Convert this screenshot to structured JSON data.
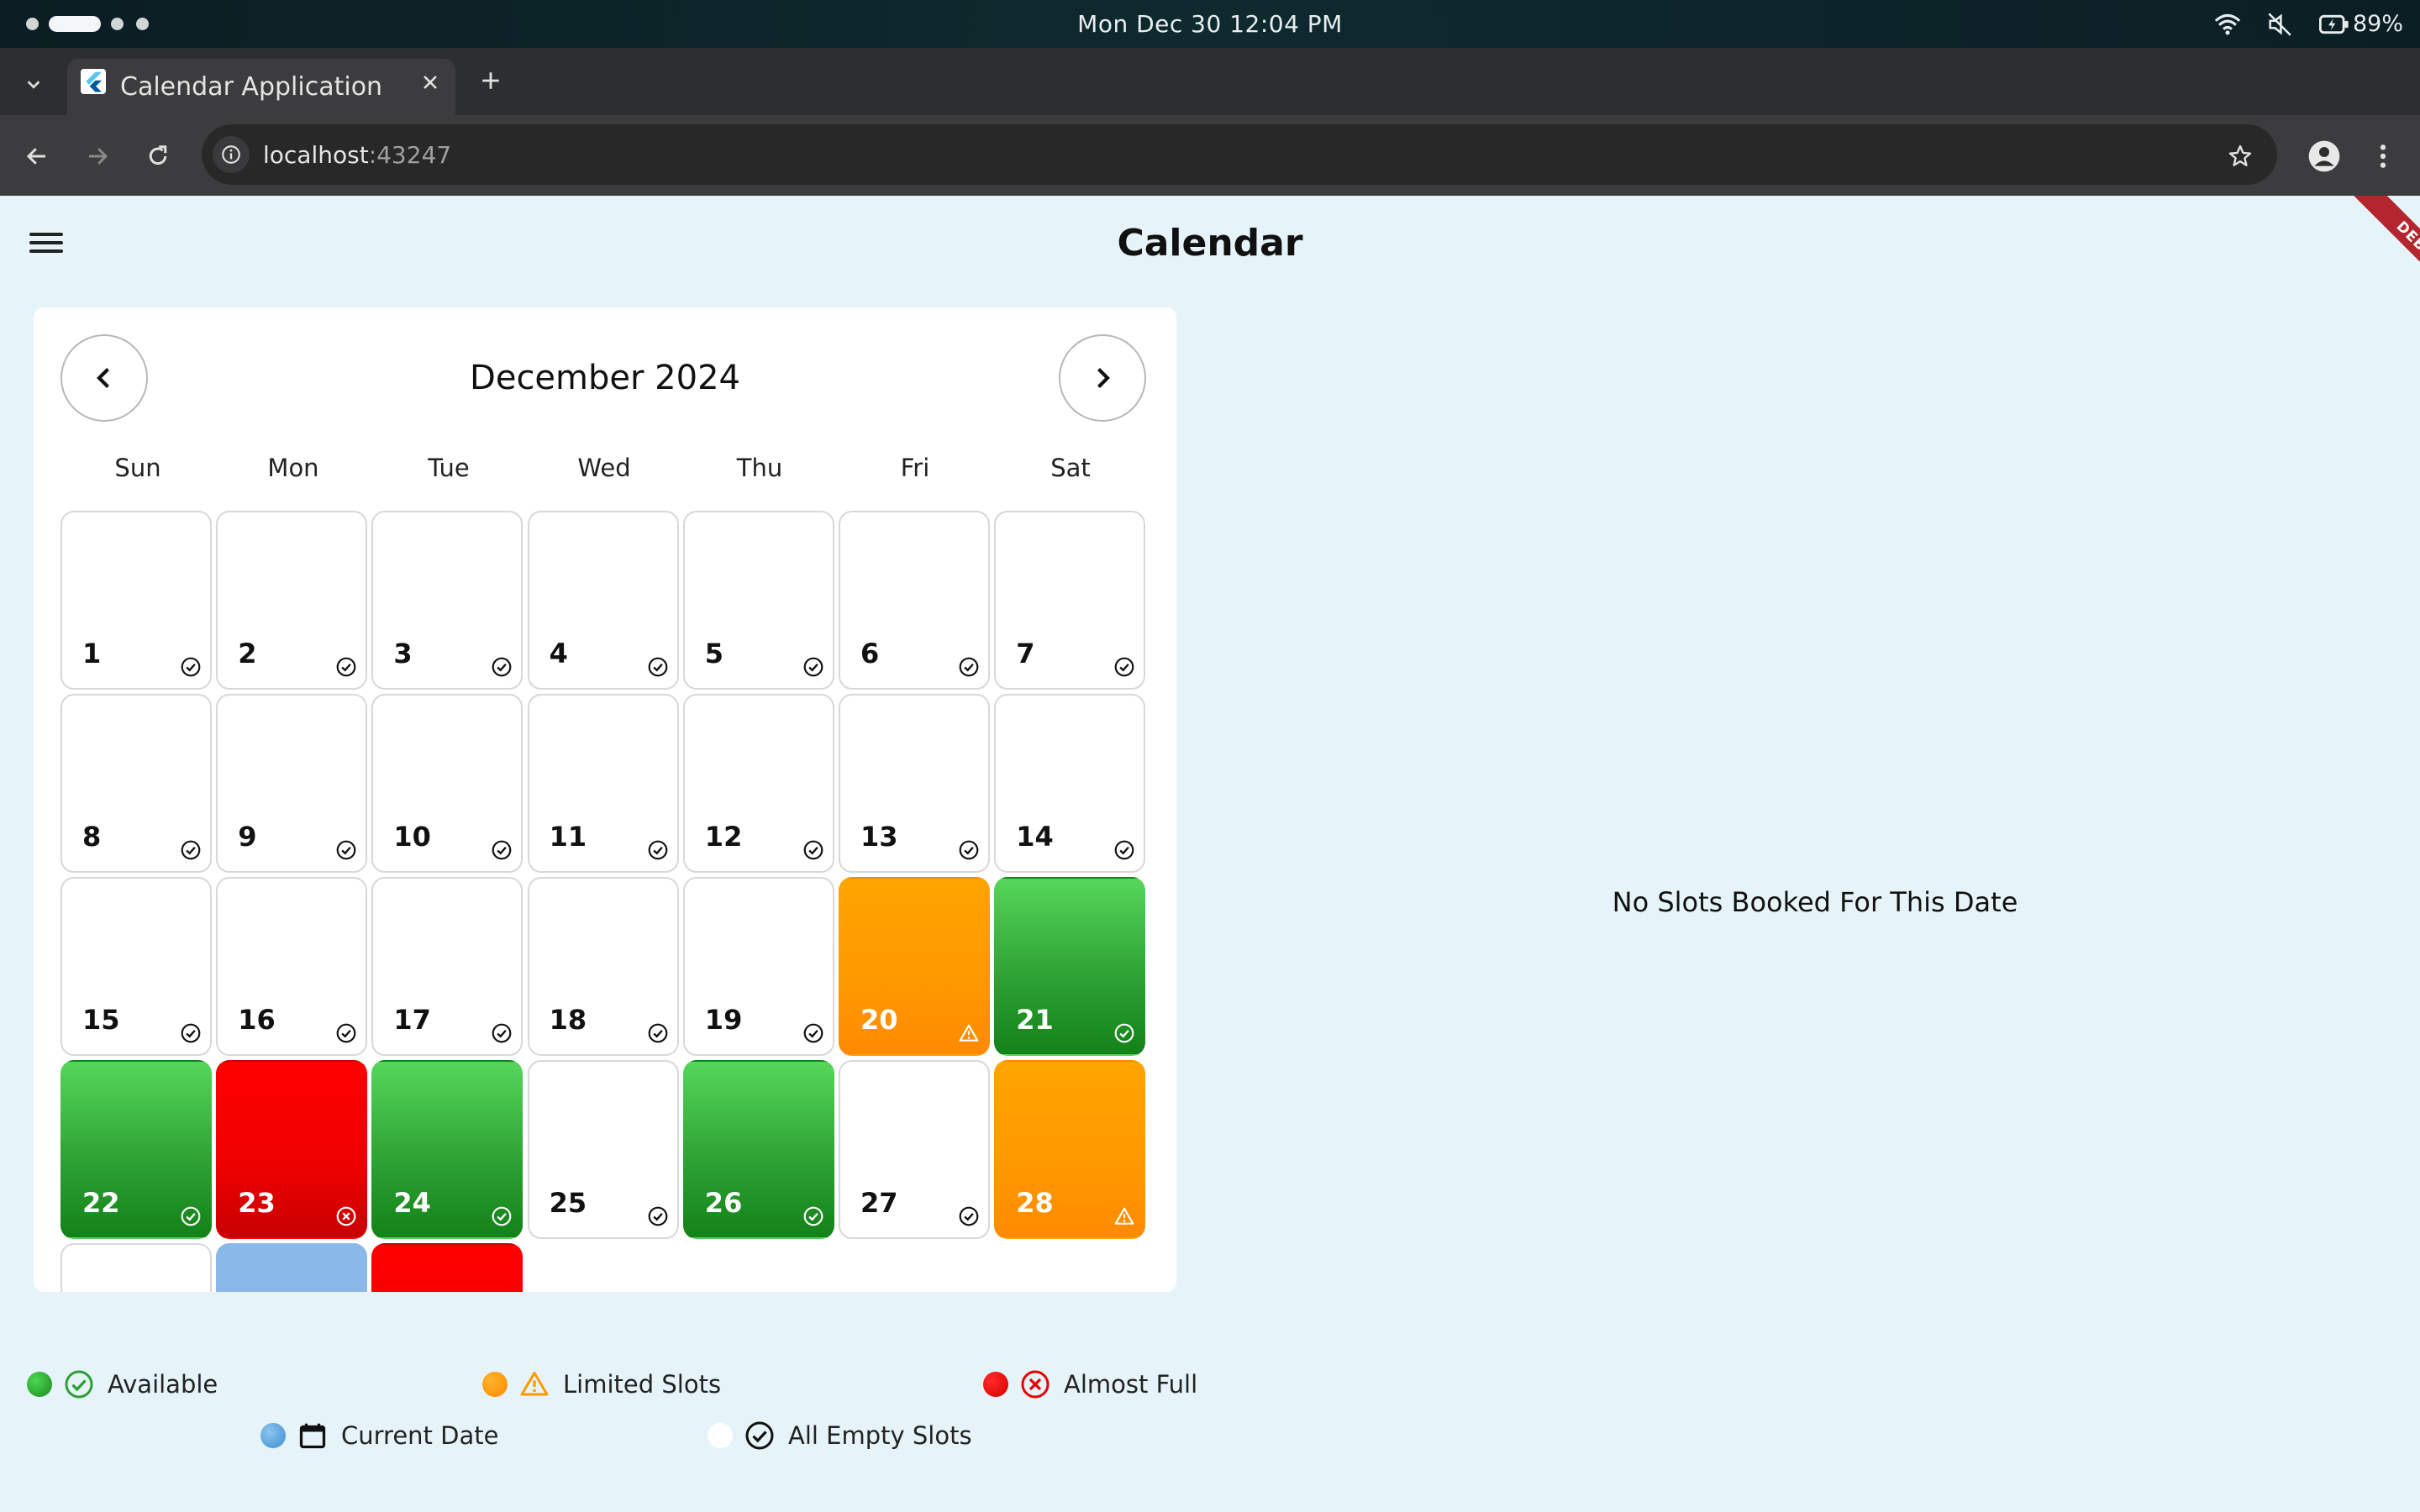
{
  "os": {
    "clock": "Mon Dec 30  12:04 PM",
    "battery": "89%"
  },
  "browser": {
    "tab_title": "Calendar Application",
    "url_host": "localhost",
    "url_port": ":43247",
    "icons": [
      "tab-list-icon",
      "flutter-icon",
      "close-tab-icon",
      "new-tab-icon",
      "back-icon",
      "forward-icon",
      "reload-icon",
      "site-info-icon",
      "bookmark-star-icon",
      "profile-icon",
      "more-icon"
    ]
  },
  "app": {
    "title": "Calendar",
    "debug_label": "DEBUG",
    "month_label": "December 2024",
    "weekdays": [
      "Sun",
      "Mon",
      "Tue",
      "Wed",
      "Thu",
      "Fri",
      "Sat"
    ],
    "no_slots_text": "No Slots Booked For This Date",
    "days": [
      {
        "n": "1",
        "s": "empty"
      },
      {
        "n": "2",
        "s": "empty"
      },
      {
        "n": "3",
        "s": "empty"
      },
      {
        "n": "4",
        "s": "empty"
      },
      {
        "n": "5",
        "s": "empty"
      },
      {
        "n": "6",
        "s": "empty"
      },
      {
        "n": "7",
        "s": "empty"
      },
      {
        "n": "8",
        "s": "empty"
      },
      {
        "n": "9",
        "s": "empty"
      },
      {
        "n": "10",
        "s": "empty"
      },
      {
        "n": "11",
        "s": "empty"
      },
      {
        "n": "12",
        "s": "empty"
      },
      {
        "n": "13",
        "s": "empty"
      },
      {
        "n": "14",
        "s": "empty"
      },
      {
        "n": "15",
        "s": "empty"
      },
      {
        "n": "16",
        "s": "empty"
      },
      {
        "n": "17",
        "s": "empty"
      },
      {
        "n": "18",
        "s": "empty"
      },
      {
        "n": "19",
        "s": "empty"
      },
      {
        "n": "20",
        "s": "limited"
      },
      {
        "n": "21",
        "s": "available"
      },
      {
        "n": "22",
        "s": "available"
      },
      {
        "n": "23",
        "s": "full"
      },
      {
        "n": "24",
        "s": "available"
      },
      {
        "n": "25",
        "s": "empty"
      },
      {
        "n": "26",
        "s": "available"
      },
      {
        "n": "27",
        "s": "empty"
      },
      {
        "n": "28",
        "s": "limited"
      },
      {
        "n": "",
        "s": "empty"
      },
      {
        "n": "",
        "s": "current"
      },
      {
        "n": "",
        "s": "full"
      }
    ],
    "legend": [
      {
        "label": "Available",
        "color": "#2e9e33",
        "icon": "check-circle-icon"
      },
      {
        "label": "Limited Slots",
        "color": "#ff9800",
        "icon": "warning-icon"
      },
      {
        "label": "Almost Full",
        "color": "#e60000",
        "icon": "x-circle-icon"
      },
      {
        "label": "Current Date",
        "color": "#5aa5de",
        "icon": "calendar-icon"
      },
      {
        "label": "All Empty Slots",
        "color": "#ffffff",
        "icon": "check-circle-icon"
      }
    ],
    "colors": {
      "available": "#2e9e33",
      "limited": "#ff9800",
      "full": "#e60000",
      "current": "#8ab8e8",
      "background": "#e6f4fa"
    }
  }
}
